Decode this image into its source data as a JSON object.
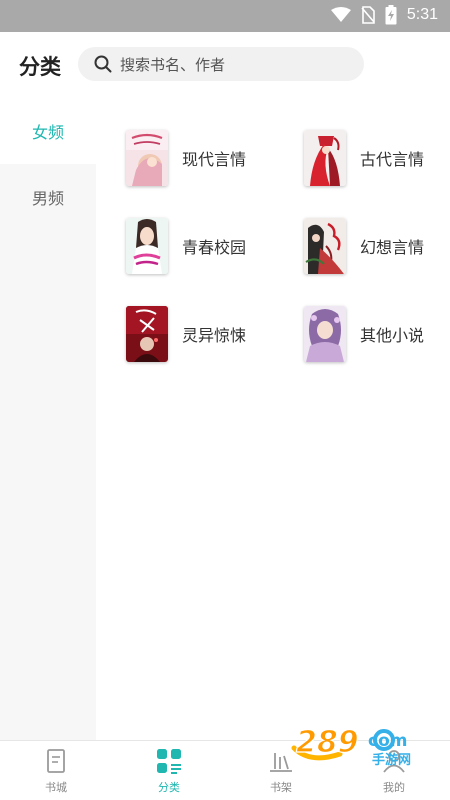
{
  "status_bar": {
    "time": "5:31"
  },
  "header": {
    "title": "分类"
  },
  "search": {
    "placeholder": "搜索书名、作者"
  },
  "sidebar": {
    "items": [
      {
        "label": "女频",
        "active": true
      },
      {
        "label": "男频",
        "active": false
      }
    ]
  },
  "categories": [
    {
      "label": "现代言情",
      "cover_icon": "book-cover-modern-romance"
    },
    {
      "label": "古代言情",
      "cover_icon": "book-cover-ancient-romance"
    },
    {
      "label": "青春校园",
      "cover_icon": "book-cover-youth-campus"
    },
    {
      "label": "幻想言情",
      "cover_icon": "book-cover-fantasy-romance"
    },
    {
      "label": "灵异惊悚",
      "cover_icon": "book-cover-supernatural"
    },
    {
      "label": "其他小说",
      "cover_icon": "book-cover-other"
    }
  ],
  "bottom_nav": {
    "items": [
      {
        "label": "书城",
        "active": false
      },
      {
        "label": "分类",
        "active": true
      },
      {
        "label": "书架",
        "active": false
      },
      {
        "label": "我的",
        "active": false
      }
    ]
  },
  "colors": {
    "accent": "#1fb7b0",
    "status_bar": "#a9a9a9",
    "sidebar_bg": "#f7f7f7"
  },
  "watermark": {
    "number": "289",
    "suffix": "com",
    "text": "手游网"
  }
}
